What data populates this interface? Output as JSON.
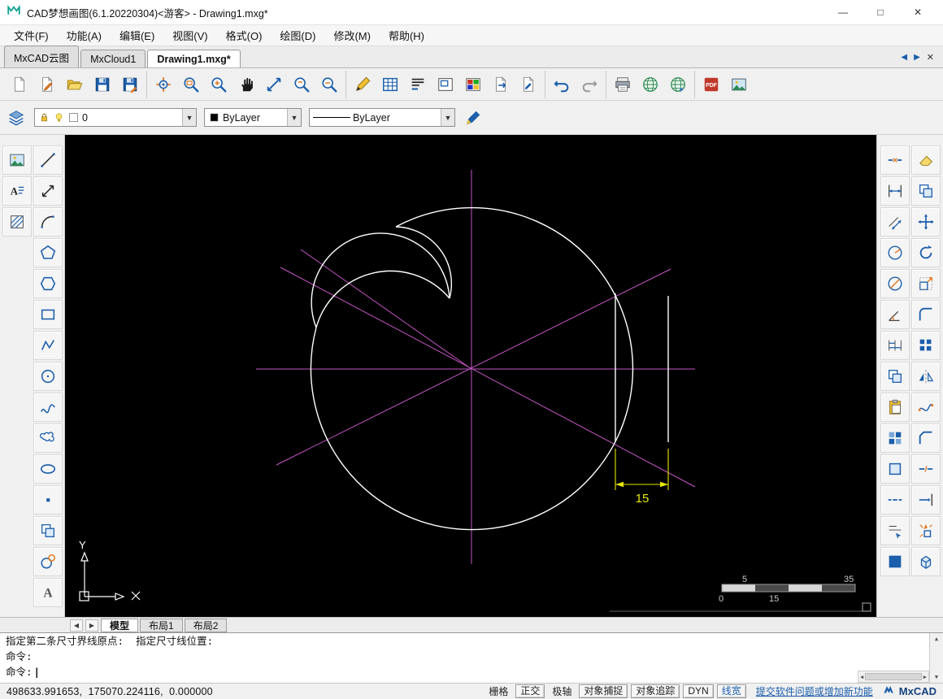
{
  "titlebar": {
    "title": "CAD梦想画图(6.1.20220304)<游客> - Drawing1.mxg*",
    "minimize_glyph": "—",
    "maximize_glyph": "□",
    "close_glyph": "✕"
  },
  "menubar": {
    "items": [
      "文件(F)",
      "功能(A)",
      "编辑(E)",
      "视图(V)",
      "格式(O)",
      "绘图(D)",
      "修改(M)",
      "帮助(H)"
    ]
  },
  "doc_tabs": {
    "tabs": [
      {
        "label": "MxCAD云图",
        "active": false
      },
      {
        "label": "MxCloud1",
        "active": false
      },
      {
        "label": "Drawing1.mxg*",
        "active": true
      }
    ]
  },
  "toolbar": {
    "groups": [
      {
        "icons": [
          "new-file",
          "sketch-pen",
          "open-file",
          "save",
          "save-as"
        ]
      },
      {
        "icons": [
          "zoom-extents",
          "zoom-window",
          "zoom-in",
          "pan",
          "zoom-scale",
          "zoom-previous",
          "zoom-out"
        ]
      },
      {
        "icons": [
          "quick-pen",
          "insert-table",
          "mtext",
          "viewport",
          "palette",
          "layout-export",
          "sheet-edit"
        ]
      },
      {
        "icons": [
          "undo",
          "redo"
        ]
      },
      {
        "icons": [
          "print",
          "publish-web",
          "web-transfer"
        ]
      },
      {
        "icons": [
          "export-pdf",
          "insert-image"
        ]
      }
    ]
  },
  "properties_bar": {
    "layer_value": "0",
    "color_value": "ByLayer",
    "linetype_value": "ByLayer"
  },
  "left_toolbar": {
    "col1": [
      "raster-image",
      "text-style",
      "hatch"
    ],
    "col2": [
      "line",
      "stretch",
      "arc",
      "pentagon",
      "polygon",
      "rectangle",
      "polyline",
      "circle",
      "spline",
      "revcloud",
      "ellipse-arc",
      "point",
      "copy-object",
      "tangent-circle",
      "text"
    ]
  },
  "right_toolbar": {
    "col1": [
      "trim",
      "dim-linear",
      "dim-aligned",
      "dim-radius",
      "dim-diameter",
      "dim-angular",
      "dim-baseline",
      "copy-clip",
      "paste-clip",
      "block",
      "region",
      "measure",
      "match-prop",
      "palette-big"
    ],
    "col2": [
      "erase",
      "copy",
      "move",
      "rotate",
      "scale",
      "fillet",
      "array",
      "mirror",
      "edit-spline",
      "chamfer",
      "break",
      "extend",
      "explode",
      "cube"
    ]
  },
  "canvas": {
    "dimension_text": "15",
    "scale_bar": {
      "label_top_left": "5",
      "label_top_right": "35",
      "label_bottom_left": "0",
      "label_bottom_mid": "15"
    },
    "ucs": {
      "y_label": "Y"
    }
  },
  "layout_tabs": {
    "tabs": [
      {
        "label": "模型",
        "active": true
      },
      {
        "label": "布局1",
        "active": false
      },
      {
        "label": "布局2",
        "active": false
      }
    ]
  },
  "command_area": {
    "lines": [
      "指定第二条尺寸界线原点:  指定尺寸线位置:",
      "命令:",
      "命令:"
    ],
    "caret": "|"
  },
  "status_bar": {
    "coordinates": "498633.991653,  175070.224116,  0.000000",
    "toggles": [
      {
        "label": "栅格",
        "boxed": false
      },
      {
        "label": "正交",
        "boxed": true
      },
      {
        "label": "极轴",
        "boxed": false
      },
      {
        "label": "对象捕捉",
        "boxed": true
      },
      {
        "label": "对象追踪",
        "boxed": true
      },
      {
        "label": "DYN",
        "boxed": true
      },
      {
        "label": "线宽",
        "boxed": true,
        "accent": true
      }
    ],
    "feedback_link": "提交软件问题或增加新功能",
    "brand": "MxCAD"
  },
  "icons": {
    "dropdown_arrow": "▼",
    "scroll_up": "▲",
    "scroll_down": "▼",
    "scroll_left": "◀",
    "scroll_right": "▶",
    "tab_nav_left": "◀",
    "tab_nav_right": "▶",
    "tab_close": "✕"
  },
  "colors": {
    "accent_blue": "#1b5eab",
    "canvas_background": "#000000",
    "geometry_white": "#ffffff",
    "construction_magenta": "#c455c4",
    "dimension_yellow": "#e8e800"
  }
}
